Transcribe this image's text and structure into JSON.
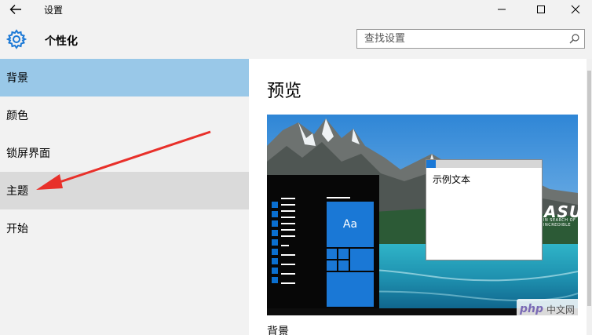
{
  "window": {
    "title": "设置",
    "back_icon": "arrow-left-icon",
    "minimize_icon": "minimize-icon",
    "maximize_icon": "maximize-icon",
    "close_icon": "close-icon"
  },
  "header": {
    "icon": "gear-icon",
    "title": "个性化",
    "search_placeholder": "查找设置",
    "search_icon": "search-icon"
  },
  "sidebar": {
    "items": [
      {
        "label": "背景",
        "state": "selected"
      },
      {
        "label": "颜色",
        "state": "normal"
      },
      {
        "label": "锁屏界面",
        "state": "normal"
      },
      {
        "label": "主题",
        "state": "hover"
      },
      {
        "label": "开始",
        "state": "normal"
      }
    ]
  },
  "main": {
    "preview_title": "预览",
    "sample_window_text": "示例文本",
    "tile_label": "Aa",
    "wallpaper_brand": "ASUS",
    "wallpaper_brand_sub": "IN SEARCH OF INCREDIBLE",
    "section_label": "背景"
  },
  "watermark": {
    "logo": "php",
    "text": "中文网"
  },
  "colors": {
    "accent": "#1a78d6",
    "selected_bg": "#99c8e8",
    "hover_bg": "#dadada",
    "panel_bg": "#f2f2f2",
    "annotation_arrow": "#e8302a"
  }
}
